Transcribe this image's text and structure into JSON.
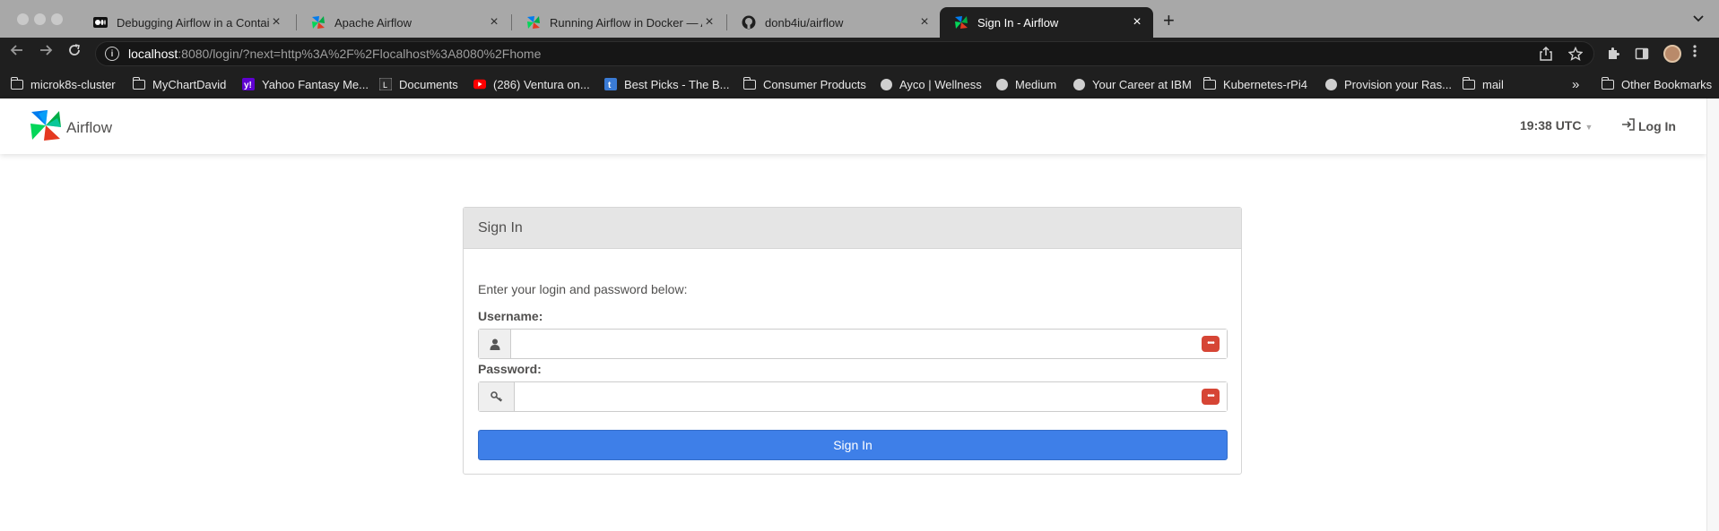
{
  "browser": {
    "tabs": [
      {
        "title": "Debugging Airflow in a Containe",
        "favicon": "medium-logo-icon",
        "active": false
      },
      {
        "title": "Apache Airflow",
        "favicon": "airflow-pinwheel-icon",
        "active": false
      },
      {
        "title": "Running Airflow in Docker — Ai",
        "favicon": "airflow-pinwheel-icon",
        "active": false
      },
      {
        "title": "donb4iu/airflow",
        "favicon": "github-icon",
        "active": false
      },
      {
        "title": "Sign In - Airflow",
        "favicon": "airflow-pinwheel-icon",
        "active": true
      }
    ],
    "new_tab": "+",
    "url_host": "localhost",
    "url_rest": ":8080/login/?next=http%3A%2F%2Flocalhost%3A8080%2Fhome",
    "bookmarks": [
      {
        "label": "microk8s-cluster",
        "icon": "folder-icon"
      },
      {
        "label": "MyChartDavid",
        "icon": "folder-icon"
      },
      {
        "label": "Yahoo Fantasy Me...",
        "icon": "yahoo-icon"
      },
      {
        "label": "Documents",
        "icon": "document-icon"
      },
      {
        "label": "(286) Ventura on...",
        "icon": "youtube-icon"
      },
      {
        "label": "Best Picks - The B...",
        "icon": "tumblr-icon"
      },
      {
        "label": "Consumer Products",
        "icon": "folder-icon"
      },
      {
        "label": "Ayco | Wellness",
        "icon": "globe-icon"
      },
      {
        "label": "Medium",
        "icon": "globe-icon"
      },
      {
        "label": "Your Career at IBM",
        "icon": "globe-icon"
      },
      {
        "label": "Kubernetes-rPi4",
        "icon": "folder-icon"
      },
      {
        "label": "Provision your Ras...",
        "icon": "globe-icon"
      },
      {
        "label": "mail",
        "icon": "folder-icon"
      }
    ],
    "more_bookmarks": "»",
    "other_bookmarks": "Other Bookmarks"
  },
  "app": {
    "brand": "Airflow",
    "time": "19:38 UTC",
    "login_link": "Log In"
  },
  "login": {
    "heading": "Sign In",
    "intro": "Enter your login and password below:",
    "username_label": "Username:",
    "username_value": "",
    "password_label": "Password:",
    "password_value": "",
    "submit_label": "Sign In"
  }
}
